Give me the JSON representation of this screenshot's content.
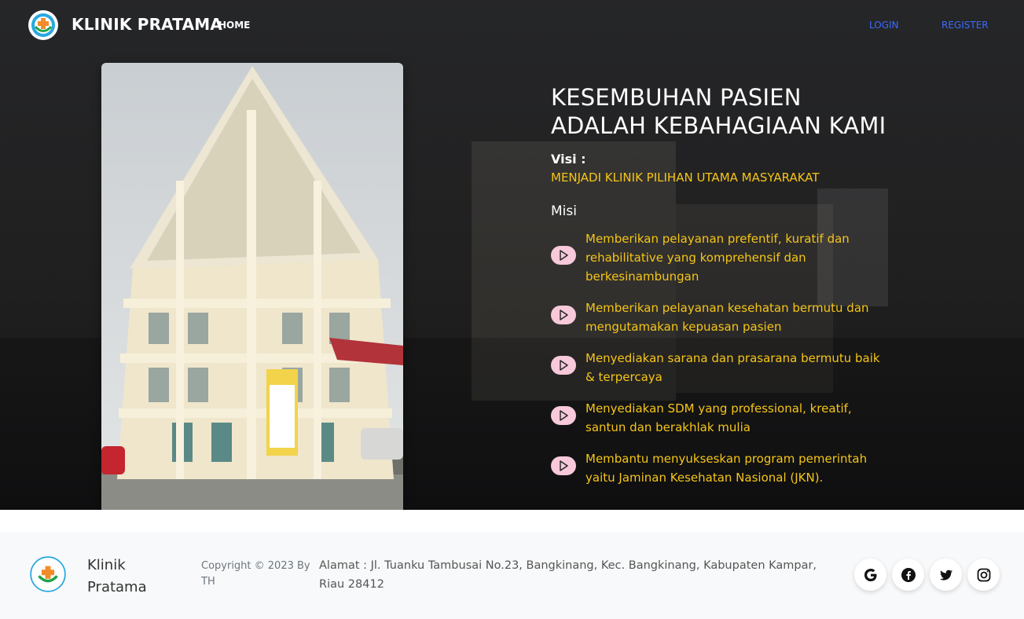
{
  "navbar": {
    "brand": "KLINIK PRATAMA",
    "home": "HOME",
    "login": "LOGIN",
    "register": "REGISTER"
  },
  "hero": {
    "headline_line1": "KESEMBUHAN PASIEN",
    "headline_line2": "ADALAH KEBAHAGIAAN KAMI",
    "visi_label": "Visi :",
    "visi_text": "MENJADI KLINIK PILIHAN UTAMA MASYARAKAT",
    "misi_label": "Misi",
    "misi": [
      "Memberikan pelayanan prefentif, kuratif dan rehabilitative yang komprehensif dan berkesinambungan",
      "Memberikan pelayanan kesehatan bermutu dan mengutamakan kepuasan pasien",
      "Menyediakan sarana dan prasarana bermutu baik & terpercaya",
      "Menyediakan SDM yang professional, kreatif, santun dan berakhlak mulia",
      "Membantu menyukseskan program pemerintah yaitu Jaminan Kesehatan Nasional (JKN)."
    ]
  },
  "footer": {
    "brand": "Klinik Pratama",
    "copyright": "Copyright © 2023 By TH",
    "address": "Alamat : Jl. Tuanku Tambusai No.23, Bangkinang, Kec. Bangkinang, Kabupaten Kampar, Riau 28412",
    "social": [
      "google-icon",
      "facebook-icon",
      "twitter-icon",
      "instagram-icon"
    ]
  },
  "colors": {
    "accent_yellow": "#f5c518",
    "nav_link_blue": "#3b6bff",
    "play_pink": "#f7c9da",
    "footer_bg": "#f8f9fa"
  }
}
